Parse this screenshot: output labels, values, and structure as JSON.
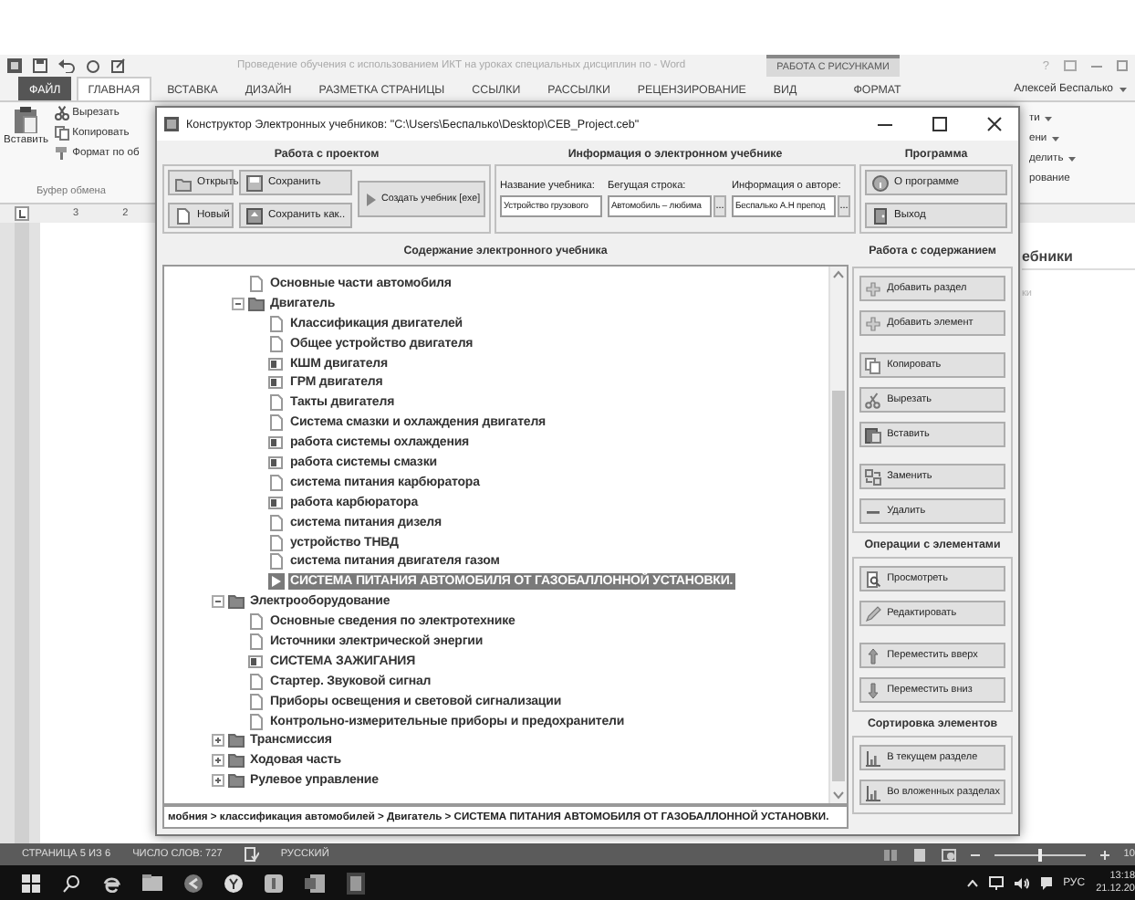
{
  "word": {
    "title": "Проведение обучения с использованием ИКТ на уроках специальных дисциплин по - Word",
    "help": "?",
    "contextual_group": "РАБОТА С РИСУНКАМИ",
    "tabs": [
      {
        "label": "ФАЙЛ",
        "kind": "file",
        "selected": false
      },
      {
        "label": "ГЛАВНАЯ",
        "kind": "normal",
        "selected": true
      },
      {
        "label": "ВСТАВКА",
        "kind": "normal",
        "selected": false
      },
      {
        "label": "ДИЗАЙН",
        "kind": "normal",
        "selected": false
      },
      {
        "label": "РАЗМЕТКА СТРАНИЦЫ",
        "kind": "normal",
        "selected": false
      },
      {
        "label": "ССЫЛКИ",
        "kind": "normal",
        "selected": false
      },
      {
        "label": "РАССЫЛКИ",
        "kind": "normal",
        "selected": false
      },
      {
        "label": "РЕЦЕНЗИРОВАНИЕ",
        "kind": "normal",
        "selected": false
      },
      {
        "label": "ВИД",
        "kind": "normal",
        "selected": false
      },
      {
        "label": "ФОРМАТ",
        "kind": "contextual",
        "selected": false
      }
    ],
    "user": "Алексей Беспалько",
    "clipboard": {
      "paste": "Вставить",
      "cut": "Вырезать",
      "copy": "Копировать",
      "format_painter": "Формат по об",
      "group_label": "Буфер обмена"
    },
    "ribbon_right": [
      {
        "text": "ти",
        "dropdown": true
      },
      {
        "text": "ени",
        "dropdown": true
      },
      {
        "text": "делить",
        "dropdown": true
      },
      {
        "text": "рование",
        "dropdown": false
      }
    ],
    "ruler_numbers": [
      "3",
      "2"
    ],
    "document": {
      "heading": "ебники",
      "line": "ки"
    }
  },
  "dialog": {
    "title": "Конструктор Электронных учебников: \"C:\\Users\\Беспалько\\Desktop\\CEB_Project.ceb\"",
    "project": {
      "title": "Работа с проектом",
      "buttons": [
        {
          "label": "Открыть",
          "kind": "open"
        },
        {
          "label": "Сохранить",
          "kind": "save"
        },
        {
          "label": "Новый",
          "kind": "new"
        },
        {
          "label": "Сохранить как..",
          "kind": "save_as"
        }
      ],
      "build": "Создать учебник [exe]"
    },
    "info": {
      "title": "Информация о электронном учебнике",
      "fields": [
        {
          "label": "Название учебника:",
          "value": "Устройство грузового"
        },
        {
          "label": "Бегущая строка:",
          "value": "Автомобиль – любима",
          "browse": "..."
        },
        {
          "label": "Информация о авторе:",
          "value": "Беспалько А.Н препод",
          "browse": "..."
        }
      ]
    },
    "program": {
      "title": "Программа",
      "buttons": [
        {
          "label": "О программе",
          "kind": "about"
        },
        {
          "label": "Выход",
          "kind": "exit"
        }
      ]
    },
    "content": {
      "title": "Содержание электронного учебника",
      "items_under_scrolled_parent": [
        {
          "label": "Основные части автомобиля",
          "kind": "page",
          "selected": false
        },
        {
          "label": "Двигатель",
          "kind": "folder",
          "expanded": true,
          "selected": false,
          "children": [
            {
              "label": "Классификация двигателей",
              "kind": "page",
              "selected": false
            },
            {
              "label": "Общее устройство двигателя",
              "kind": "page",
              "selected": false
            },
            {
              "label": "КШМ двигателя",
              "kind": "media",
              "selected": false
            },
            {
              "label": "ГРМ двигателя",
              "kind": "media",
              "selected": false
            },
            {
              "label": "Такты двигателя",
              "kind": "page",
              "selected": false
            },
            {
              "label": "Система смазки и охлаждения двигателя",
              "kind": "page",
              "selected": false
            },
            {
              "label": "работа системы охлаждения",
              "kind": "media",
              "selected": false
            },
            {
              "label": "работа системы смазки",
              "kind": "media",
              "selected": false
            },
            {
              "label": "система питания карбюратора",
              "kind": "page",
              "selected": false
            },
            {
              "label": "работа карбюратора",
              "kind": "media",
              "selected": false
            },
            {
              "label": "система питания дизеля",
              "kind": "page",
              "selected": false
            },
            {
              "label": "устройство ТНВД",
              "kind": "page",
              "selected": false
            },
            {
              "label": "система питания двигателя газом",
              "kind": "page",
              "selected": false
            },
            {
              "label": "СИСТЕМА ПИТАНИЯ АВТОМОБИЛЯ ОТ ГАЗОБАЛЛОННОЙ УСТАНОВКИ.",
              "kind": "video",
              "selected": true
            }
          ]
        }
      ],
      "items": [
        {
          "label": "Электрооборудование",
          "kind": "folder",
          "expanded": true,
          "selected": false,
          "children": [
            {
              "label": "Основные сведения по электротехнике",
              "kind": "page",
              "selected": false
            },
            {
              "label": "Источники электрической энергии",
              "kind": "page",
              "selected": false
            },
            {
              "label": "СИСТЕМА ЗАЖИГАНИЯ",
              "kind": "media",
              "selected": false
            },
            {
              "label": "Стартер. Звуковой сигнал",
              "kind": "page",
              "selected": false
            },
            {
              "label": "Приборы освещения и световой сигнализации",
              "kind": "page",
              "selected": false
            },
            {
              "label": "Контрольно-измерительные приборы и предохранители",
              "kind": "page",
              "selected": false
            }
          ]
        },
        {
          "label": "Трансмиссия",
          "kind": "folder",
          "expanded": false,
          "selected": false
        },
        {
          "label": "Ходовая часть",
          "kind": "folder",
          "expanded": false,
          "selected": false
        },
        {
          "label": "Рулевое управление",
          "kind": "folder",
          "expanded": false,
          "selected": false
        }
      ],
      "path": "мобния > классификация автомобилей > Двигатель > СИСТЕМА ПИТАНИЯ АВТОМОБИЛЯ ОТ ГАЗОБАЛЛОННОЙ УСТАНОВКИ."
    },
    "sections": [
      {
        "title": "Работа с содержанием",
        "button_groups": [
          [
            {
              "label": "Добавить раздел",
              "kind": "add"
            },
            {
              "label": "Добавить элемент",
              "kind": "add"
            }
          ],
          [
            {
              "label": "Копировать",
              "kind": "copy"
            },
            {
              "label": "Вырезать",
              "kind": "cut"
            },
            {
              "label": "Вставить",
              "kind": "paste"
            }
          ],
          [
            {
              "label": "Заменить",
              "kind": "replace"
            },
            {
              "label": "Удалить",
              "kind": "delete"
            }
          ]
        ]
      },
      {
        "title": "Операции с элементами",
        "button_groups": [
          [
            {
              "label": "Просмотреть",
              "kind": "view"
            },
            {
              "label": "Редактировать",
              "kind": "edit"
            }
          ],
          [
            {
              "label": "Переместить вверх",
              "kind": "up"
            },
            {
              "label": "Переместить вниз",
              "kind": "down"
            }
          ]
        ]
      },
      {
        "title": "Сортировка элементов",
        "button_groups": [
          [
            {
              "label": "В текущем разделе",
              "kind": "sort"
            },
            {
              "label": "Во вложенных разделах",
              "kind": "sort"
            }
          ]
        ]
      }
    ]
  },
  "status_bar": {
    "page": "СТРАНИЦА 5 ИЗ 6",
    "words": "ЧИСЛО СЛОВ: 727",
    "language": "РУССКИЙ",
    "zoom_slider": {
      "level": 0.5
    },
    "zoom": "10"
  },
  "taskbar": {
    "language": "РУС",
    "time": "13:18",
    "date": "21.12.20"
  }
}
